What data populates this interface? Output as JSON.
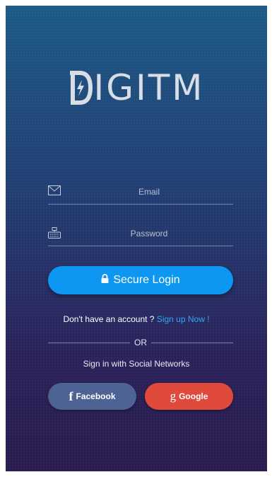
{
  "app": {
    "logo_text": "IGITM",
    "logo_mark_icon": "bolt-d-icon"
  },
  "form": {
    "email": {
      "placeholder": "Email",
      "value": "",
      "icon": "envelope-icon"
    },
    "password": {
      "placeholder": "Password",
      "value": "",
      "icon": "keyboard-icon"
    },
    "login_label": "Secure Login",
    "login_icon": "lock-icon"
  },
  "signup": {
    "prompt": "Don't have an account ?",
    "link_label": "Sign up Now !"
  },
  "divider": {
    "label": "OR"
  },
  "social": {
    "caption": "Sign in with Social Networks",
    "facebook_label": "Facebook",
    "facebook_glyph": "f",
    "google_label": "Google",
    "google_glyph": "g"
  },
  "colors": {
    "primary": "#0e97f0",
    "link": "#33a7f5",
    "facebook": "#4c6394",
    "google": "#e04a3c",
    "bg_top": "#1d5a86",
    "bg_bottom": "#2a1c4e"
  }
}
